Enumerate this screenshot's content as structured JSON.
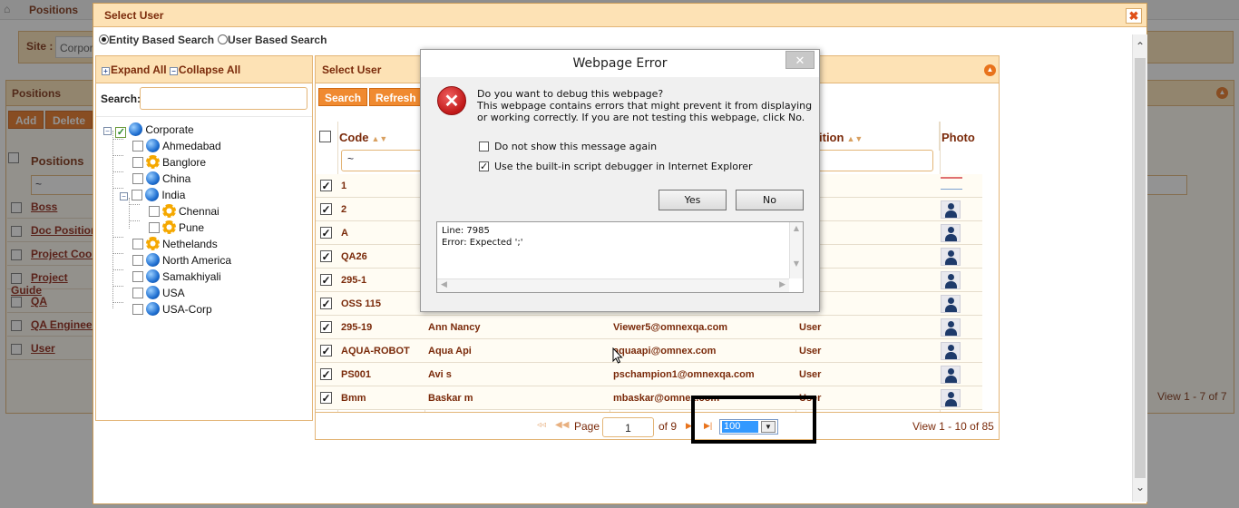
{
  "background": {
    "breadcrumb": "Positions",
    "site_label": "Site :",
    "site_value": "Corpor",
    "panel_title": "Positions",
    "add_label": "Add",
    "delete_label": "Delete",
    "column_header": "Positions",
    "rows": [
      "Boss",
      "Doc Position",
      "Project Coor",
      "Project Guide",
      "QA",
      "QA Engineer",
      "User"
    ],
    "view_text": "View 1 - 7 of 7"
  },
  "dialog": {
    "title": "Select User",
    "close_icon": "close-icon",
    "search_modes": [
      {
        "label": "Entity Based Search",
        "selected": true
      },
      {
        "label": "User Based Search",
        "selected": false
      }
    ]
  },
  "tree": {
    "expand_all": "Expand All",
    "collapse_all": "Collapse All",
    "search_label": "Search:",
    "search_value": "",
    "nodes": [
      {
        "label": "Corporate",
        "icon": "globe-icon",
        "checked": true
      },
      {
        "label": "Ahmedabad",
        "icon": "globe-icon",
        "checked": false
      },
      {
        "label": "Banglore",
        "icon": "gear-icon",
        "checked": false
      },
      {
        "label": "China",
        "icon": "globe-icon",
        "checked": false
      },
      {
        "label": "India",
        "icon": "globe-icon",
        "checked": false
      },
      {
        "label": "Chennai",
        "icon": "gear-icon",
        "checked": false
      },
      {
        "label": "Pune",
        "icon": "gear-icon",
        "checked": false
      },
      {
        "label": "Nethelands",
        "icon": "gear-icon",
        "checked": false
      },
      {
        "label": "North America",
        "icon": "globe-icon",
        "checked": false
      },
      {
        "label": "Samakhiyali",
        "icon": "globe-icon",
        "checked": false
      },
      {
        "label": "USA",
        "icon": "globe-icon",
        "checked": false
      },
      {
        "label": "USA-Corp",
        "icon": "globe-icon",
        "checked": false
      }
    ]
  },
  "grid": {
    "title": "Select User",
    "search_button": "Search",
    "refresh_button": "Refresh",
    "columns": {
      "code": "Code",
      "position": "ition",
      "photo": "Photo"
    },
    "code_filter": "~",
    "rows": [
      {
        "code": "1",
        "name": "",
        "email": "",
        "position": ""
      },
      {
        "code": "2",
        "name": "",
        "email": "",
        "position": ""
      },
      {
        "code": "A",
        "name": "",
        "email": "",
        "position": ""
      },
      {
        "code": "QA26",
        "name": "",
        "email": "",
        "position": ""
      },
      {
        "code": "295-1",
        "name": "",
        "email": "",
        "position": ""
      },
      {
        "code": "OSS 115",
        "name": "",
        "email": "",
        "position": ""
      },
      {
        "code": "295-19",
        "name": "Ann  Nancy",
        "email": "Viewer5@omnexqa.com",
        "position": "User"
      },
      {
        "code": "AQUA-ROBOT",
        "name": "Aqua  Api",
        "email": "aquaapi@omnex.com",
        "position": "User"
      },
      {
        "code": "PS001",
        "name": "Avi  s",
        "email": "pschampion1@omnexqa.com",
        "position": "User"
      },
      {
        "code": "Bmm",
        "name": "Baskar  m",
        "email": "mbaskar@omnex.com",
        "position": "User"
      }
    ],
    "pager": {
      "page_label": "Page",
      "page_value": "1",
      "of_text": "of 9",
      "rows_per_page": "100",
      "view_text": "View 1 - 10 of 85"
    }
  },
  "error_dialog": {
    "title": "Webpage Error",
    "close_glyph": "✕",
    "message_line1": "Do you want to debug this webpage?",
    "message_line2": "This webpage contains errors that might prevent it from displaying or working correctly. If you are not testing this webpage, click No.",
    "check1": {
      "label": "Do not show this message again",
      "checked": false
    },
    "check2": {
      "label": "Use the built-in script debugger in Internet Explorer",
      "checked": true
    },
    "yes_label": "Yes",
    "no_label": "No",
    "detail_line1": "Line: 7985",
    "detail_line2": "Error: Expected ';'"
  },
  "colors": {
    "header_bg": "#fde2b5",
    "accent": "#e8731c",
    "text_brown": "#7a2a0a"
  }
}
